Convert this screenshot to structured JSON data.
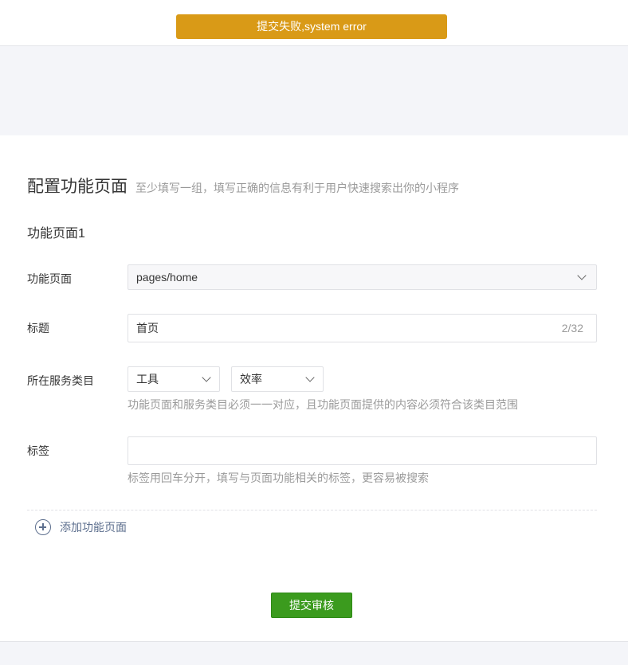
{
  "toast": {
    "message": "提交失败,system error",
    "color": "#d99a17"
  },
  "section": {
    "title": "配置功能页面",
    "tip": "至少填写一组，填写正确的信息有利于用户快速搜索出你的小程序"
  },
  "group": {
    "title": "功能页面1",
    "page_label": "功能页面",
    "page_value": "pages/home",
    "title_label": "标题",
    "title_value": "首页",
    "title_counter": "2/32",
    "category_label": "所在服务类目",
    "category_primary": "工具",
    "category_secondary": "效率",
    "category_hint": "功能页面和服务类目必须一一对应，且功能页面提供的内容必须符合该类目范围",
    "tags_label": "标签",
    "tags_value": "",
    "tags_hint": "标签用回车分开，填写与页面功能相关的标签，更容易被搜索"
  },
  "add_page_label": "添加功能页面",
  "submit_label": "提交审核",
  "colors": {
    "accent_green": "#3b9b1e",
    "link": "#5d6f8e",
    "warning": "#d99a17"
  },
  "icons": [
    "chevron-down-icon",
    "plus-circle-icon"
  ]
}
